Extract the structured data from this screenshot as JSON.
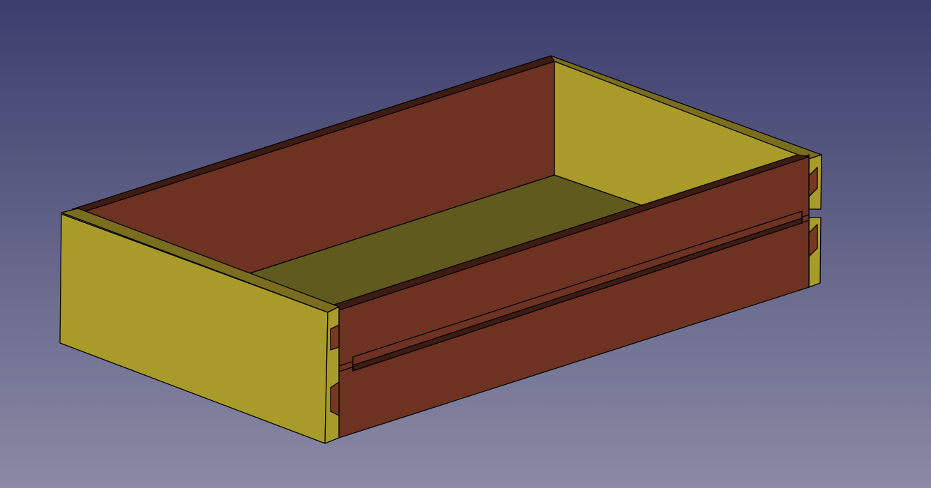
{
  "viewport": {
    "background_top_color": "#3c3d6d",
    "background_bottom_color": "#8a8aa4"
  },
  "model": {
    "kind": "drawer-box",
    "parts": [
      "left-side-panel",
      "back-panel",
      "right-side-panel",
      "bottom-panel",
      "front-panel",
      "front-groove",
      "dovetail-joints"
    ],
    "colors": {
      "side_face": "#a89b2a",
      "side_edge": "#7a6e1e",
      "bottom_face": "#605a1e",
      "front_face": "#6e3222",
      "front_edge": "#3e1b13",
      "dovetail_recess": "#77391f",
      "outline": "#000000"
    }
  }
}
